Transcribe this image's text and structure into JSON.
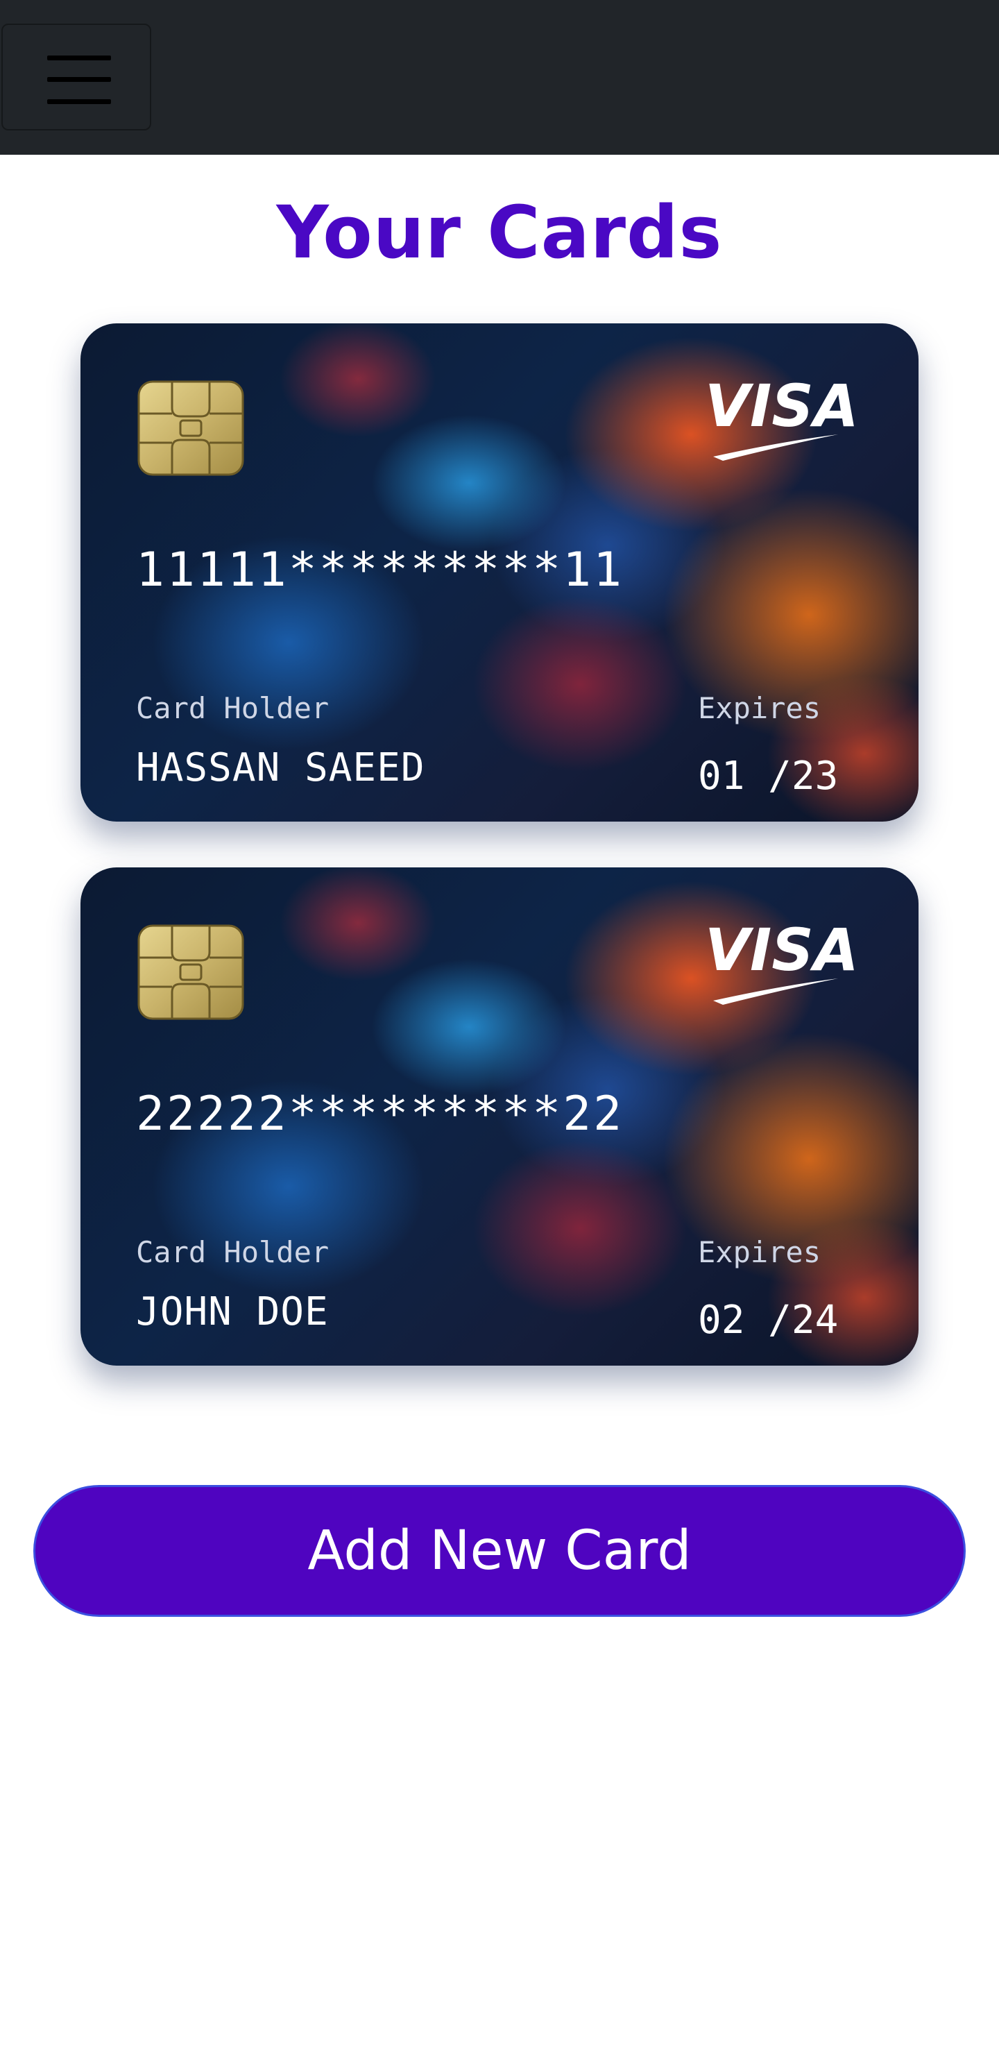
{
  "page": {
    "title": "Your Cards"
  },
  "navbar": {
    "menu_icon": "hamburger-icon"
  },
  "cards": [
    {
      "brand": "VISA",
      "number": "11111*********11",
      "holder_label": "Card Holder",
      "holder_name": "HASSAN SAEED",
      "expires_label": "Expires",
      "expiry": "01 /23"
    },
    {
      "brand": "VISA",
      "number": "22222*********22",
      "holder_label": "Card Holder",
      "holder_name": "JOHN DOE",
      "expires_label": "Expires",
      "expiry": "02 /24"
    }
  ],
  "actions": {
    "add_card_label": "Add New Card"
  },
  "colors": {
    "navbar": "#212529",
    "title": "#4a08c4",
    "button": "#4f04c0"
  }
}
